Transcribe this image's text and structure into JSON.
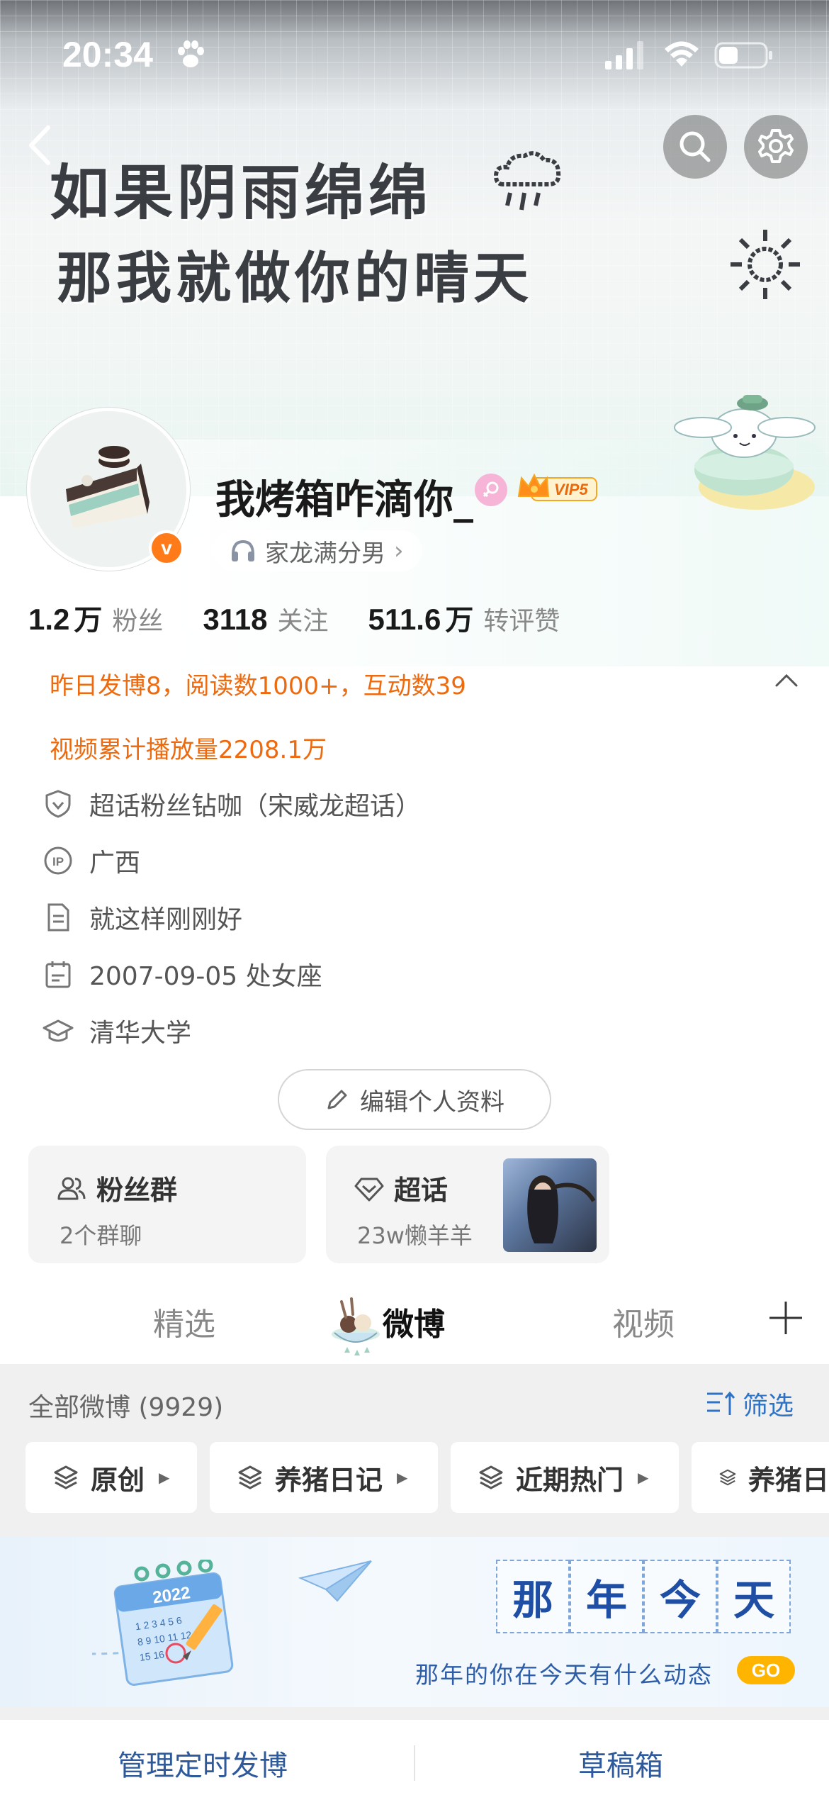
{
  "status_bar": {
    "time": "20:34"
  },
  "banner": {
    "line1": "如果阴雨绵绵",
    "line2": "那我就做你的晴天"
  },
  "profile": {
    "username": "我烤箱咋滴你_",
    "vip_label": "VIP5",
    "verified_mark": "v",
    "tag_label": "家龙满分男",
    "tag_chevron": "›"
  },
  "stats": [
    {
      "num": "1.2",
      "unit": "万",
      "label": "粉丝"
    },
    {
      "num": "3118",
      "unit": "",
      "label": "关注"
    },
    {
      "num": "511.6",
      "unit": "万",
      "label": "转评赞"
    }
  ],
  "summary": {
    "line1": "昨日发博8，阅读数1000+，互动数39",
    "line2": "视频累计播放量2208.1万"
  },
  "info": [
    {
      "icon": "shield-icon",
      "text": "超话粉丝钻咖（宋威龙超话）"
    },
    {
      "icon": "ip-icon",
      "text": "广西"
    },
    {
      "icon": "document-icon",
      "text": "就这样刚刚好"
    },
    {
      "icon": "calendar-icon",
      "text": "2007-09-05 处女座"
    },
    {
      "icon": "graduation-icon",
      "text": "清华大学"
    }
  ],
  "edit_profile_label": "编辑个人资料",
  "cards": {
    "fans": {
      "title": "粉丝群",
      "sub": "2个群聊"
    },
    "topic": {
      "title": "超话",
      "sub": "23w懒羊羊"
    }
  },
  "tabs": [
    "精选",
    "微博",
    "视频"
  ],
  "active_tab": "微博",
  "feed": {
    "header": "全部微博 (9929)",
    "filter_label": "筛选",
    "chips": [
      "原创",
      "养猪日记",
      "近期热门",
      "养猪日"
    ]
  },
  "memory_banner": {
    "calendar_year": "2022",
    "stamps": [
      "那",
      "年",
      "今",
      "天"
    ],
    "text": "那年的你在今天有什么动态",
    "go_label": "GO"
  },
  "bottom_bar": {
    "left": "管理定时发博",
    "right": "草稿箱"
  },
  "colors": {
    "accent_orange": "#ee6a0f",
    "link_blue": "#2f73c7",
    "vip_gold": "#f5a623",
    "verified_orange": "#ff7b1a"
  }
}
